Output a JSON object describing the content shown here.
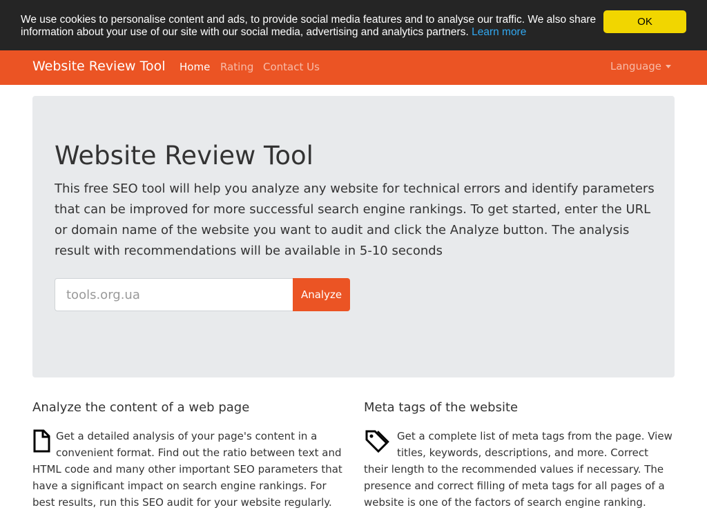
{
  "cookie": {
    "text": "We use cookies to personalise content and ads, to provide social media features and to analyse our traffic. We also share information about your use of our site with our social media, advertising and analytics partners.",
    "link": "Learn more",
    "button": "OK"
  },
  "navbar": {
    "brand": "Website Review Tool",
    "links": [
      {
        "label": "Home"
      },
      {
        "label": "Rating"
      },
      {
        "label": "Contact Us"
      }
    ],
    "language": "Language",
    "accent_color": "#eb5424"
  },
  "hero": {
    "title": "Website Review Tool",
    "lead": "This free SEO tool will help you analyze any website for technical errors and identify parameters that can be improved for more successful search engine rankings. To get started, enter the URL or domain name of the website you want to audit and click the Analyze button. The analysis result with recommendations will be available in 5-10 seconds",
    "input_placeholder": "tools.org.ua",
    "button": "Analyze"
  },
  "features": [
    {
      "title": "Analyze the content of a web page",
      "icon": "file-icon",
      "text": "Get a detailed analysis of your page's content in a convenient format. Find out the ratio between text and HTML code and many other important SEO parameters that have a significant impact on search engine rankings. For best results, run this SEO audit for your website regularly."
    },
    {
      "title": "Meta tags of the website",
      "icon": "tag-icon",
      "text": "Get a complete list of meta tags from the page. View titles, keywords, descriptions, and more. Correct their length to the recommended values if necessary. The presence and correct filling of meta tags for all pages of a website is one of the factors of search engine ranking."
    }
  ]
}
